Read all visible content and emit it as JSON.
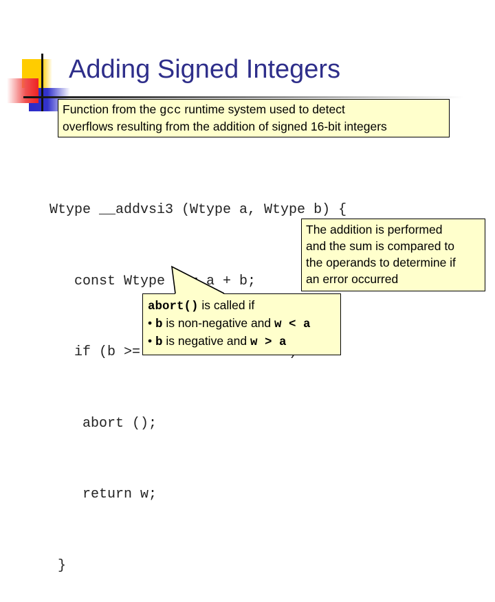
{
  "slide": {
    "title": "Adding Signed Integers",
    "intro_note": {
      "part1": "Function from the ",
      "gcc": "gcc",
      "part2": " runtime system used to detect",
      "line2": "overflows resulting from the addition of signed 16-bit integers"
    },
    "code_lines": [
      "Wtype __addvsi3 (Wtype a, Wtype b) {",
      "   const Wtype w = a + b;",
      "   if (b >= 0 ? w < a : w > a)",
      "    abort ();",
      "    return w;",
      " }"
    ],
    "right_note": {
      "lines": [
        "The addition is performed",
        "and the sum is compared to",
        "the operands to determine if",
        "an error occurred"
      ]
    },
    "bottom_note": {
      "header_code": "abort()",
      "header_text": " is called if",
      "bullet_symbol": "•",
      "bullets": [
        {
          "var": "b",
          "text": " is non-negative and ",
          "cond": "w < a"
        },
        {
          "var": "b",
          "text": " is negative and ",
          "cond": "w > a"
        }
      ]
    },
    "colors": {
      "title": "#2e2e8a",
      "note_bg": "#ffffcc",
      "deco_yellow": "#ffcc00",
      "deco_blue": "#3333cc",
      "deco_red": "#ee2222"
    }
  }
}
